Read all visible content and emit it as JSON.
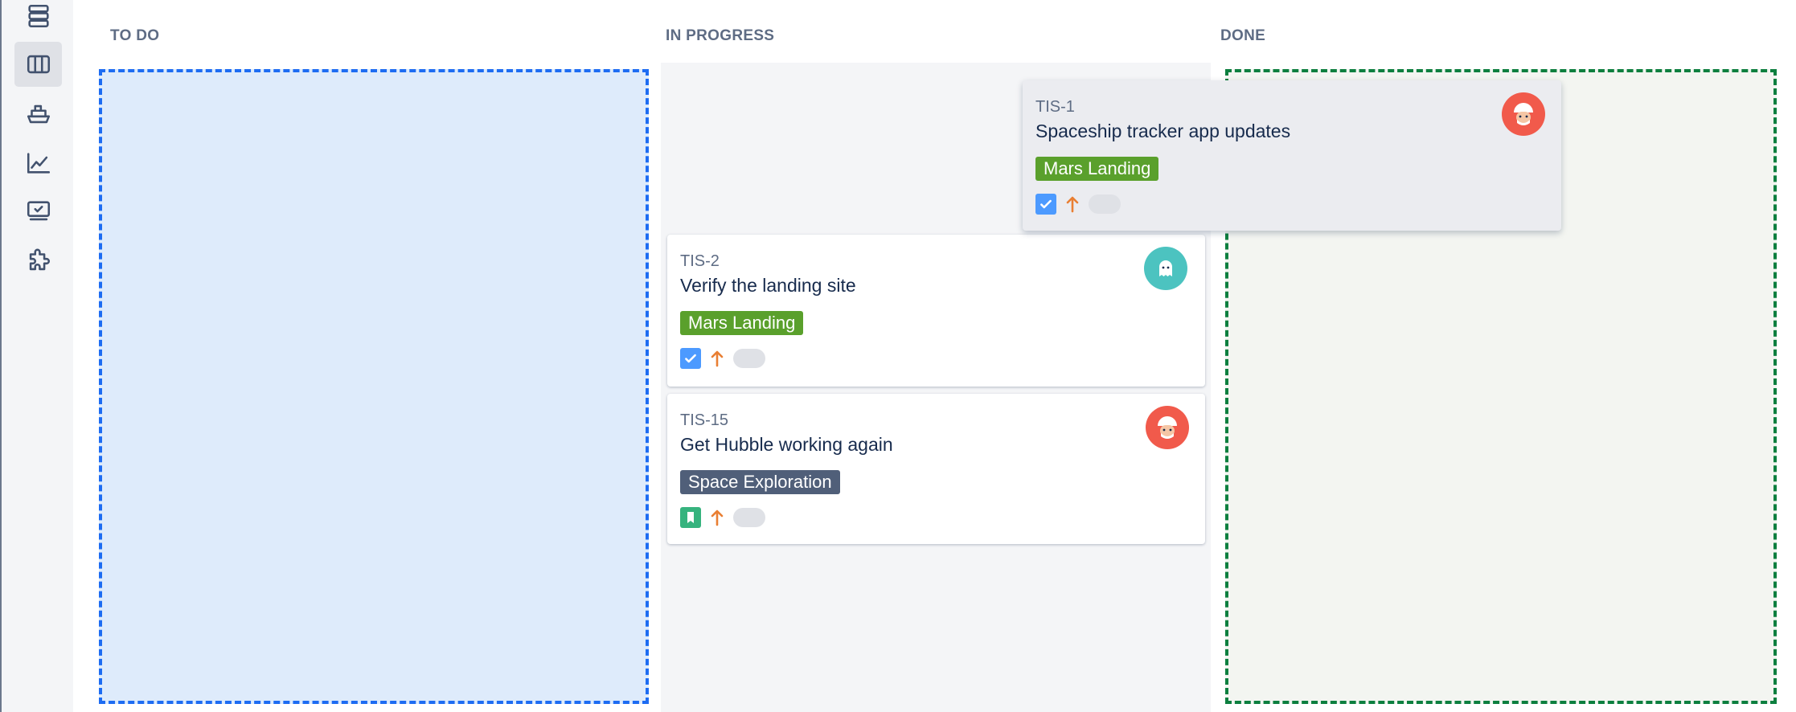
{
  "sidebar": {
    "items": [
      {
        "icon": "backlog-icon",
        "active": false
      },
      {
        "icon": "board-icon",
        "active": true
      },
      {
        "icon": "releases-icon",
        "active": false
      },
      {
        "icon": "reports-icon",
        "active": false
      },
      {
        "icon": "issues-icon",
        "active": false
      },
      {
        "icon": "addons-icon",
        "active": false
      }
    ]
  },
  "columns": [
    {
      "title": "TO DO"
    },
    {
      "title": "IN PROGRESS"
    },
    {
      "title": "DONE"
    }
  ],
  "cards": [
    {
      "key": "TIS-1",
      "title": "Spaceship tracker app updates",
      "epic": "Mars Landing",
      "type": "task-icon",
      "priority": "priority-high-icon",
      "assignee": "avatar-astronaut-icon",
      "state": "dragging"
    },
    {
      "key": "TIS-2",
      "title": "Verify the landing site",
      "epic": "Mars Landing",
      "type": "task-icon",
      "priority": "priority-high-icon",
      "assignee": "avatar-ghost-icon",
      "column": "IN PROGRESS"
    },
    {
      "key": "TIS-15",
      "title": "Get Hubble working again",
      "epic": "Space Exploration",
      "type": "story-icon",
      "priority": "priority-high-icon",
      "assignee": "avatar-astronaut-icon",
      "column": "IN PROGRESS"
    }
  ],
  "colors": {
    "accent": "#1d6cf2",
    "done_zone": "#0d7f3f",
    "epic_mars": "#5aa02c",
    "epic_space": "#505f79",
    "priority": "#e97f33"
  }
}
